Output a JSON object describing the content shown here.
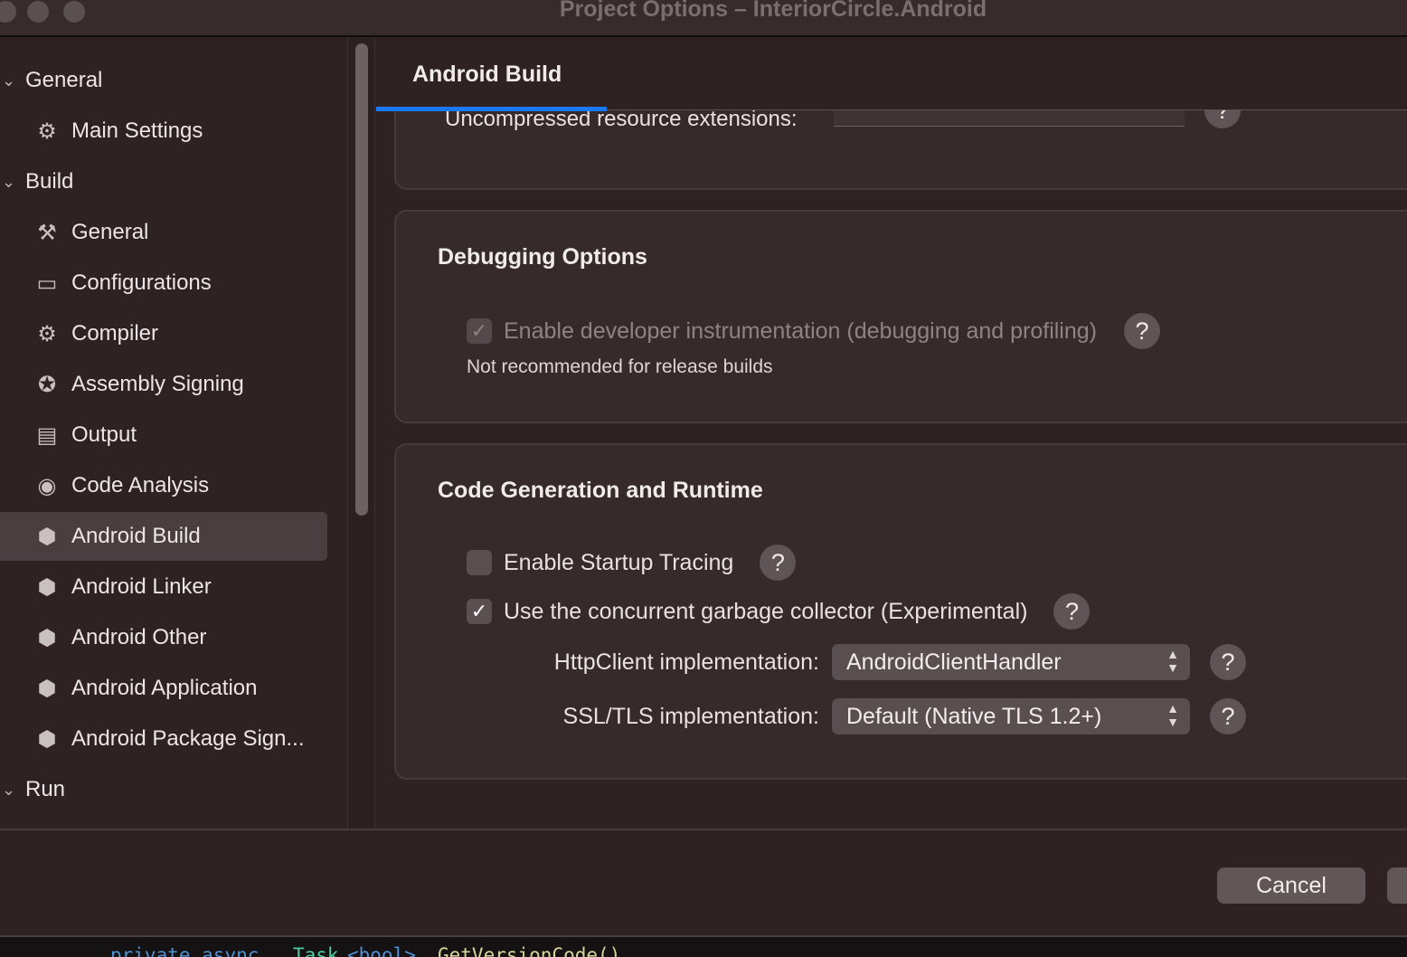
{
  "window": {
    "title": "Project Options – InteriorCircle.Android"
  },
  "sidebar": {
    "items": [
      {
        "label": "General",
        "type": "group",
        "icon": "chevron-down-icon"
      },
      {
        "label": "Main Settings",
        "type": "item",
        "icon": "gear-icon"
      },
      {
        "label": "Build",
        "type": "group",
        "icon": "chevron-down-icon"
      },
      {
        "label": "General",
        "type": "item",
        "icon": "hammer-icon"
      },
      {
        "label": "Configurations",
        "type": "item",
        "icon": "window-icon"
      },
      {
        "label": "Compiler",
        "type": "item",
        "icon": "compiler-icon"
      },
      {
        "label": "Assembly Signing",
        "type": "item",
        "icon": "seal-icon"
      },
      {
        "label": "Output",
        "type": "item",
        "icon": "document-icon"
      },
      {
        "label": "Code Analysis",
        "type": "item",
        "icon": "target-icon"
      },
      {
        "label": "Android Build",
        "type": "item",
        "icon": "android-icon",
        "selected": true
      },
      {
        "label": "Android Linker",
        "type": "item",
        "icon": "android-icon"
      },
      {
        "label": "Android Other",
        "type": "item",
        "icon": "android-icon"
      },
      {
        "label": "Android Application",
        "type": "item",
        "icon": "android-icon"
      },
      {
        "label": "Android Package Sign...",
        "type": "item",
        "icon": "android-icon"
      },
      {
        "label": "Run",
        "type": "group",
        "icon": "chevron-down-icon"
      }
    ]
  },
  "tabs": [
    {
      "label": "Android Build",
      "active": true
    }
  ],
  "accent": "#1a78f2",
  "packaging": {
    "uncompressed_label": "Uncompressed resource extensions:",
    "uncompressed_value": ""
  },
  "debugging": {
    "title": "Debugging Options",
    "dev_instr_label": "Enable developer instrumentation (debugging and profiling)",
    "dev_instr_checked": true,
    "dev_instr_disabled": true,
    "note": "Not recommended for release builds"
  },
  "codegen": {
    "title": "Code Generation and Runtime",
    "startup_tracing_label": "Enable Startup Tracing",
    "startup_tracing_checked": false,
    "concurrent_gc_label": "Use the concurrent garbage collector (Experimental)",
    "concurrent_gc_checked": true,
    "httpclient_label": "HttpClient implementation:",
    "httpclient_value": "AndroidClientHandler",
    "ssl_label": "SSL/TLS implementation:",
    "ssl_value": "Default (Native TLS 1.2+)"
  },
  "help_glyph": "?",
  "footer": {
    "cancel": "Cancel"
  },
  "code": {
    "line": [
      "private async ",
      "Task",
      "<bool> ",
      "GetVersionCode()"
    ]
  }
}
